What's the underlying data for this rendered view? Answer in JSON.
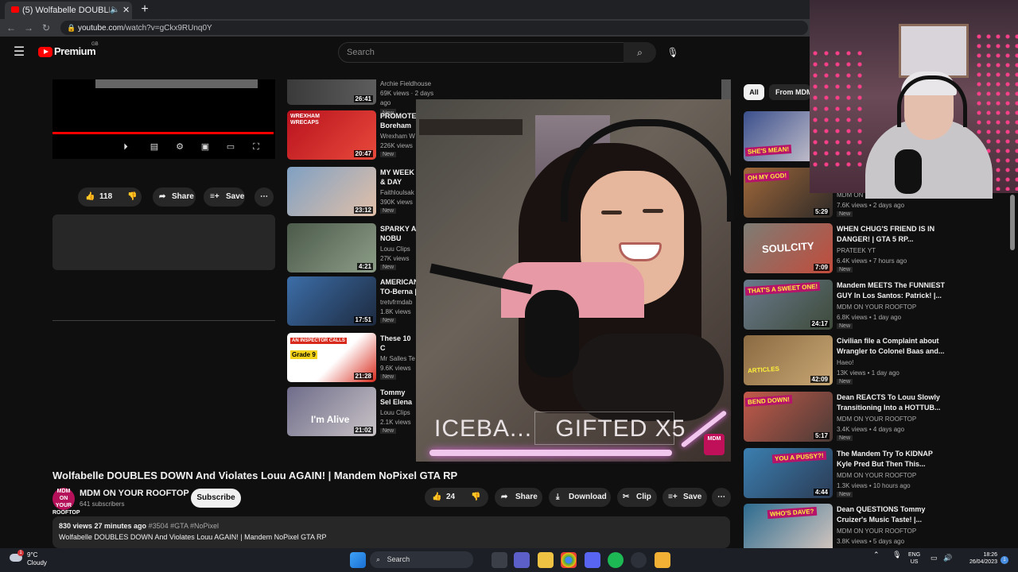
{
  "browser": {
    "tab_title": "(5) Wolfabelle DOUBLES DOWN And Violates Louu AGAIN! | Mandem NoPixel GTA RP",
    "tab_close": "✕",
    "new_tab": "+",
    "url_host": "youtube.com",
    "url_path": "/watch?v=gCkx9RUnq0Y"
  },
  "youtube": {
    "logo_text": "Premium",
    "country_code": "GB",
    "search_placeholder": "Search"
  },
  "player_actions": {
    "like_count": "118",
    "share": "Share",
    "save": "Save"
  },
  "related_top": {
    "channel": "Archie Fieldhouse",
    "meta": "69K views · 2 days ago",
    "badge": "New",
    "duration": "26:41"
  },
  "related": [
    {
      "title": "PROMOTEI Boreham W",
      "channel": "Wrexham W",
      "views": "226K views",
      "badge": "New",
      "duration": "20:47",
      "colors": [
        "#b8121e",
        "#e84a3b"
      ]
    },
    {
      "title": "MY WEEK & DAY OUT D",
      "channel": "Faithloulsak",
      "views": "390K views",
      "badge": "New",
      "duration": "23:12",
      "colors": [
        "#7fa0c3",
        "#e2c0a8"
      ]
    },
    {
      "title": "SPARKY A NOBU AND",
      "channel": "Louu Clips",
      "views": "27K views",
      "badge": "New",
      "duration": "4:21",
      "colors": [
        "#4b5a4a",
        "#8c9d87"
      ]
    },
    {
      "title": "AMERICAN TO-Berna |",
      "channel": "tretvfrmdab",
      "views": "1.8K views",
      "badge": "New",
      "duration": "17:51",
      "colors": [
        "#3c6ea8",
        "#1d2a3f"
      ]
    },
    {
      "title": "These 10 C Inspector C",
      "channel": "Mr Salles Te",
      "views": "9.6K views",
      "badge": "New",
      "duration": "21:28",
      "colors": [
        "#ffffff",
        "#d82a1c"
      ]
    },
    {
      "title": "Tommy Sel Elena",
      "channel": "Louu Clips",
      "views": "2.1K views",
      "badge": "New",
      "duration": "21:02",
      "colors": [
        "#6e6c8a",
        "#c9c3c6"
      ]
    }
  ],
  "related_thumb_text": {
    "wrexham": "WREXHAM WRECAPS",
    "inspector": "AN INSPECTOR CALLS",
    "grade": "Grade 9",
    "alive": "I'm Alive"
  },
  "overlay": {
    "caption_left": "ICEBA...",
    "caption_right": "GIFTED X5",
    "logo": "MDM"
  },
  "video": {
    "title": "Wolfabelle DOUBLES DOWN And Violates Louu AGAIN! | Mandem NoPixel GTA RP",
    "channel_name": "MDM ON YOUR ROOFTOP",
    "subscribers": "641 subscribers",
    "avatar_text": "MDM ON YOUR ROOFTOP",
    "subscribe": "Subscribe",
    "like_count": "24",
    "share": "Share",
    "download": "Download",
    "clip": "Clip",
    "save": "Save",
    "views_time": "830 views  27 minutes ago",
    "hashtags": "#3504 #GTA #NoPixel",
    "desc_line": "Wolfabelle DOUBLES DOWN And Violates Louu AGAIN! | Mandem NoPixel GTA RP"
  },
  "sidebar": {
    "chip_all": "All",
    "chip_from": "From MDM",
    "items": [
      {
        "title": "",
        "channel": "",
        "views": "",
        "badge": "",
        "duration": "",
        "tag": "SHE'S MEAN!",
        "colors": [
          "#3a4f8c",
          "#d8d0d4"
        ]
      },
      {
        "title": "",
        "channel": "MDM ON YOUR ROOFTOP",
        "views": "7.6K views • 2 days ago",
        "badge": "New",
        "duration": "5:29",
        "tag": "OH MY GOD!",
        "colors": [
          "#a0683a",
          "#2e2a28"
        ]
      },
      {
        "title": "WHEN CHUG'S FRIEND IS IN DANGER! | GTA 5 RP...",
        "channel": "PRATEEK YT",
        "views": "6.4K views • 7 hours ago",
        "badge": "New",
        "duration": "7:09",
        "tag": "SOULCITY",
        "colors": [
          "#7d7d75",
          "#c24b3b"
        ]
      },
      {
        "title": "Mandem MEETS The FUNNIEST GUY In Los Santos: Patrick! |...",
        "channel": "MDM ON YOUR ROOFTOP",
        "views": "6.8K views • 1 day ago",
        "badge": "New",
        "duration": "24:17",
        "tag": "THAT'S A SWEET ONE!",
        "colors": [
          "#6a7a8c",
          "#3d4a3a"
        ]
      },
      {
        "title": "Civilian file a Complaint about Wrangler to Colonel Baas and...",
        "channel": "Haeo!",
        "views": "13K views • 1 day ago",
        "badge": "New",
        "duration": "42:09",
        "tag": "ARTICLES",
        "colors": [
          "#8a6a42",
          "#c9a774"
        ]
      },
      {
        "title": "Dean REACTS To Louu Slowly Transitioning Into a HOTTUB...",
        "channel": "MDM ON YOUR ROOFTOP",
        "views": "3.4K views • 4 days ago",
        "badge": "New",
        "duration": "5:17",
        "tag": "BEND DOWN!",
        "colors": [
          "#c35a4a",
          "#4a3a36"
        ]
      },
      {
        "title": "The Mandem Try To KIDNAP Kyle Pred But Then This...",
        "channel": "MDM ON YOUR ROOFTOP",
        "views": "1.3K views • 10 hours ago",
        "badge": "New",
        "duration": "4:44",
        "tag": "YOU A PUSSY?!",
        "colors": [
          "#3b7fb0",
          "#2b3b55"
        ]
      },
      {
        "title": "Dean QUESTIONS Tommy Cruizer's Music Taste! |...",
        "channel": "MDM ON YOUR ROOFTOP",
        "views": "3.8K views • 5 days ago",
        "badge": "",
        "duration": "",
        "tag": "WHO'S DAVE?",
        "colors": [
          "#2c6b8f",
          "#d7c8c0"
        ]
      }
    ]
  },
  "taskbar": {
    "temp": "9°C",
    "weather": "Cloudy",
    "weather_badge": "1",
    "search": "Search",
    "lang1": "ENG",
    "lang2": "US",
    "time": "18:26",
    "date": "26/04/2023",
    "notif": "1"
  }
}
